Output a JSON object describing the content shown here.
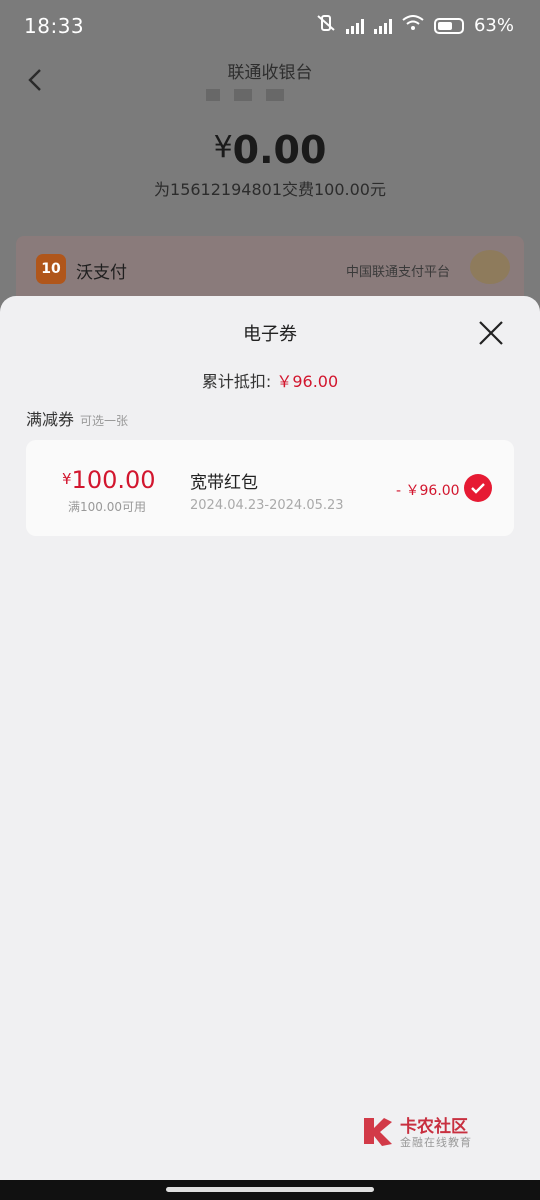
{
  "status_bar": {
    "time": "18:33",
    "battery": "63%",
    "battery_level": 0.63
  },
  "header": {
    "title": "联通收银台",
    "amount_symbol": "¥",
    "amount": "0.00",
    "description": "为15612194801交费100.00元"
  },
  "payment": {
    "name": "沃支付",
    "subtitle": "中国联通支付平台",
    "logo_text": "10"
  },
  "sheet": {
    "title": "电子券",
    "total_label": "累计抵扣:",
    "total_value": "￥96.00",
    "section_label": "满减券",
    "section_hint": "可选一张",
    "coupons": [
      {
        "currency": "¥",
        "amount": "100.00",
        "condition": "满100.00可用",
        "name": "宽带红包",
        "dates": "2024.04.23-2024.05.23",
        "deduct": "- ￥96.00",
        "selected": true
      }
    ]
  },
  "watermark": {
    "title": "卡农社区",
    "subtitle": "金融在线教育"
  },
  "colors": {
    "accent_red": "#e61a33",
    "price_red": "#d2162e",
    "sheet_bg": "#f0f0f2"
  }
}
